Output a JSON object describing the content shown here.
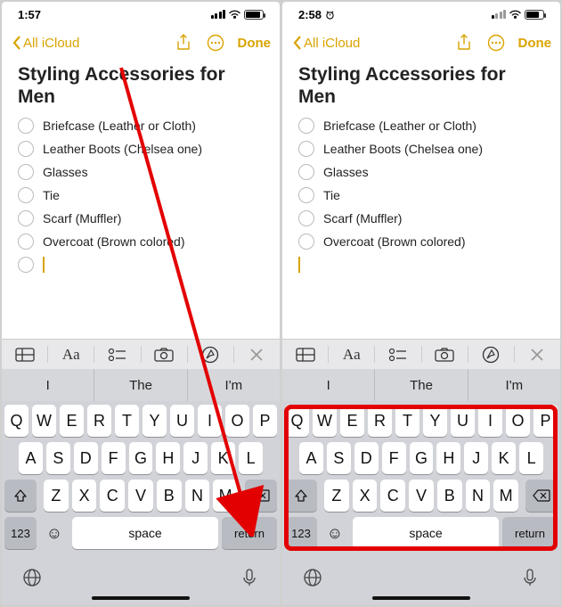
{
  "left": {
    "status": {
      "time": "1:57",
      "wifi": true,
      "battery_pct": 80,
      "signal": 4
    },
    "nav": {
      "back_label": "All iCloud",
      "done_label": "Done"
    },
    "note": {
      "title": "Styling Accessories for Men",
      "items": [
        "Briefcase (Leather or Cloth)",
        "Leather Boots (Chelsea one)",
        "Glasses",
        "Tie",
        "Scarf (Muffler)",
        "Overcoat (Brown colored)"
      ],
      "show_empty_circle": true
    },
    "predictions": [
      "I",
      "The",
      "I'm"
    ]
  },
  "right": {
    "status": {
      "time": "2:58",
      "alarm": true,
      "wifi": true,
      "battery_pct": 70,
      "signal": 1
    },
    "nav": {
      "back_label": "All iCloud",
      "done_label": "Done"
    },
    "note": {
      "title": "Styling Accessories for Men",
      "items": [
        "Briefcase (Leather or Cloth)",
        "Leather Boots (Chelsea one)",
        "Glasses",
        "Tie",
        "Scarf (Muffler)",
        "Overcoat (Brown colored)"
      ],
      "show_empty_circle": false
    },
    "predictions": [
      "I",
      "The",
      "I'm"
    ]
  },
  "toolbar_icons": [
    "table-icon",
    "textformat-icon",
    "checklist-icon",
    "camera-icon",
    "markup-icon",
    "close-icon"
  ],
  "keyboard": {
    "row1": [
      "Q",
      "W",
      "E",
      "R",
      "T",
      "Y",
      "U",
      "I",
      "O",
      "P"
    ],
    "row2": [
      "A",
      "S",
      "D",
      "F",
      "G",
      "H",
      "J",
      "K",
      "L"
    ],
    "row3": [
      "Z",
      "X",
      "C",
      "V",
      "B",
      "N",
      "M"
    ],
    "numbers_label": "123",
    "space_label": "space",
    "return_label": "return"
  },
  "icons": {
    "share": "share-icon",
    "more": "more-circle-icon",
    "globe": "globe-icon",
    "mic": "mic-icon",
    "shift": "shift-icon",
    "backspace": "backspace-icon",
    "emoji": "emoji-icon"
  }
}
